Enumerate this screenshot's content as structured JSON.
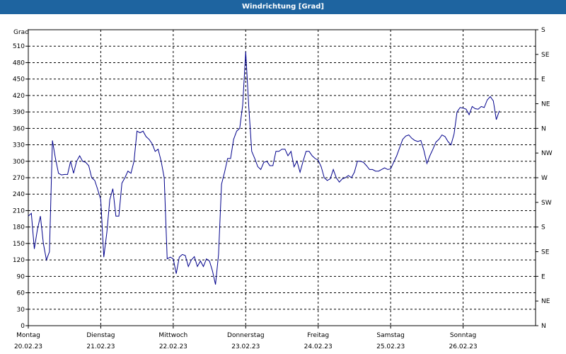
{
  "window": {
    "title": "Windrichtung [Grad]"
  },
  "colors": {
    "titlebar": "#1e64a0",
    "line": "#00008b",
    "grid": "#000000"
  },
  "chart_data": {
    "type": "line",
    "ylabel": "Grad",
    "ylim": [
      0,
      540
    ],
    "y_ticks": [
      0,
      30,
      60,
      90,
      120,
      150,
      180,
      210,
      240,
      270,
      300,
      330,
      360,
      390,
      420,
      450,
      480,
      510
    ],
    "right_axis": {
      "labels": [
        "N",
        "NE",
        "E",
        "SE",
        "S",
        "SW",
        "W",
        "NW",
        "N",
        "NE",
        "E",
        "SE",
        "S"
      ],
      "values": [
        0,
        45,
        90,
        135,
        180,
        225,
        270,
        315,
        360,
        405,
        450,
        495,
        540
      ]
    },
    "grid": true,
    "x_days": [
      {
        "day": "Montag",
        "date": "20.02.23"
      },
      {
        "day": "Dienstag",
        "date": "21.02.23"
      },
      {
        "day": "Mittwoch",
        "date": "22.02.23"
      },
      {
        "day": "Donnerstag",
        "date": "23.02.23"
      },
      {
        "day": "Freitag",
        "date": "24.02.23"
      },
      {
        "day": "Samstag",
        "date": "25.02.23"
      },
      {
        "day": "Sonntag",
        "date": "26.02.23"
      }
    ],
    "series": [
      {
        "x_hours": [
          0,
          2,
          4,
          6,
          8,
          10,
          12,
          14,
          16,
          18,
          20,
          22,
          24,
          26,
          28,
          30,
          32,
          34,
          36,
          38,
          40,
          42,
          44,
          46,
          48,
          50,
          52,
          54,
          56,
          58,
          60,
          62,
          64,
          66,
          68,
          70,
          72,
          74,
          76,
          78,
          80,
          82,
          84,
          86,
          88,
          90,
          92,
          94,
          96,
          98,
          100,
          102,
          104,
          106,
          108,
          110,
          112,
          114,
          116,
          118,
          120,
          122,
          124,
          126,
          128,
          130,
          132,
          134,
          136,
          138,
          140,
          142,
          144,
          146,
          148,
          150,
          152,
          154,
          156,
          158,
          160,
          162,
          164,
          166,
          168,
          170,
          172,
          174,
          176,
          178
        ],
        "values": [
          195,
          140,
          200,
          120,
          338,
          278,
          276,
          300,
          310,
          292,
          270,
          230,
          125,
          250,
          200,
          260,
          282,
          355,
          350,
          325,
          318,
          265,
          122,
          122,
          98,
          128,
          110,
          126,
          108,
          118,
          75,
          258,
          305,
          340,
          360,
          500,
          315,
          285,
          300,
          292,
          318,
          322,
          292,
          318,
          290,
          280,
          318,
          310,
          302,
          270,
          268,
          285,
          262,
          270,
          274,
          300,
          298,
          285,
          282,
          285,
          286,
          290,
          310,
          340,
          348,
          340,
          338,
          296,
          322,
          340,
          348,
          336,
          390,
          398,
          385,
          396,
          400,
          412,
          376,
          392
        ],
        "x_hours_full": [
          0,
          1,
          2,
          3,
          4,
          5,
          6,
          7,
          8,
          9,
          10,
          11,
          12,
          13,
          14,
          15,
          16,
          17,
          18,
          19,
          20,
          21,
          22,
          23,
          24,
          25,
          26,
          27,
          28,
          29,
          30,
          31,
          32,
          33,
          34,
          35,
          36,
          37,
          38,
          39,
          40,
          41,
          42,
          43,
          44,
          45,
          46,
          47,
          48,
          49,
          50,
          51,
          52,
          53,
          54,
          55,
          56,
          57,
          58,
          59,
          60,
          61,
          62,
          63,
          64,
          65,
          66,
          67,
          68,
          69,
          70,
          71,
          72,
          73,
          74,
          75,
          76,
          77,
          78,
          79,
          80,
          81,
          82,
          83,
          84,
          85,
          86,
          87,
          88,
          89,
          90,
          91,
          92,
          93,
          94,
          95,
          96,
          97,
          98,
          99,
          100,
          101,
          102,
          103,
          104,
          105,
          106,
          107,
          108,
          109,
          110,
          111,
          112,
          113,
          114,
          115,
          116,
          117,
          118,
          119,
          120,
          121,
          122,
          123,
          124,
          125,
          126,
          127,
          128,
          129,
          130,
          131,
          132,
          133,
          134,
          135,
          136,
          137,
          138,
          139,
          140,
          141,
          142,
          143,
          144,
          145,
          146,
          147,
          148,
          149,
          150,
          151,
          152,
          153,
          154,
          155,
          156,
          157,
          158,
          159,
          160,
          161,
          162,
          163,
          164,
          165,
          166,
          167,
          168
        ],
        "values_full": [
          200,
          205,
          140,
          175,
          200,
          150,
          120,
          135,
          338,
          305,
          278,
          275,
          276,
          276,
          300,
          278,
          300,
          310,
          300,
          298,
          292,
          270,
          265,
          248,
          230,
          125,
          170,
          230,
          250,
          200,
          200,
          260,
          270,
          282,
          278,
          300,
          355,
          352,
          355,
          345,
          340,
          332,
          318,
          322,
          300,
          270,
          122,
          125,
          122,
          95,
          125,
          130,
          128,
          108,
          120,
          126,
          108,
          118,
          108,
          122,
          118,
          100,
          75,
          130,
          258,
          280,
          305,
          305,
          340,
          355,
          360,
          402,
          500,
          400,
          318,
          305,
          290,
          285,
          298,
          300,
          292,
          292,
          318,
          318,
          322,
          322,
          310,
          318,
          290,
          300,
          280,
          300,
          318,
          318,
          310,
          305,
          302,
          290,
          270,
          265,
          268,
          285,
          270,
          262,
          268,
          270,
          274,
          270,
          280,
          300,
          300,
          298,
          292,
          285,
          285,
          282,
          282,
          285,
          288,
          285,
          286,
          298,
          310,
          325,
          340,
          346,
          348,
          342,
          338,
          336,
          338,
          320,
          296,
          310,
          322,
          335,
          340,
          348,
          345,
          336,
          330,
          350,
          390,
          398,
          397,
          395,
          385,
          400,
          396,
          395,
          400,
          398,
          412,
          418,
          410,
          376,
          392
        ]
      }
    ]
  }
}
